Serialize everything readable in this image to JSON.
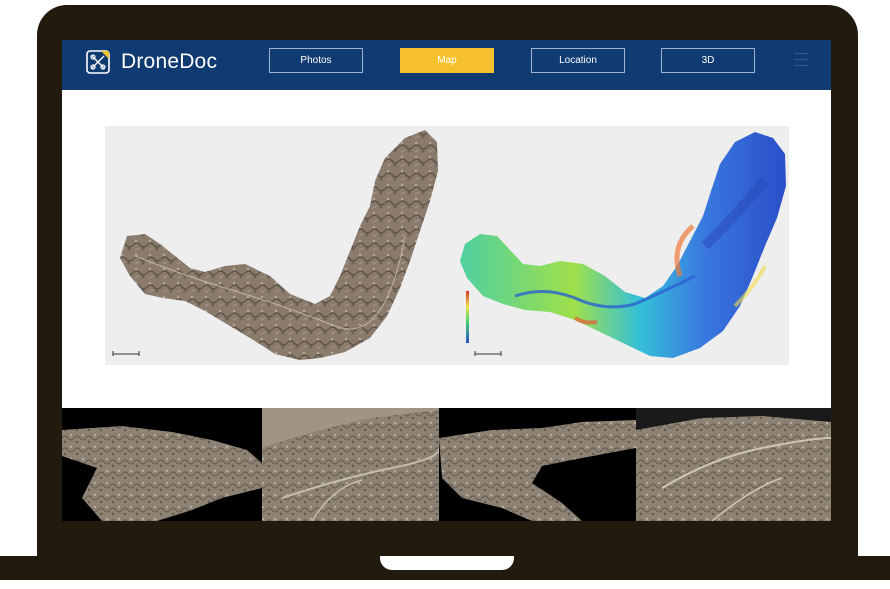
{
  "app": {
    "name": "DroneDoc"
  },
  "nav": [
    {
      "label": "Photos",
      "active": false
    },
    {
      "label": "Map",
      "active": true
    },
    {
      "label": "Location",
      "active": false
    },
    {
      "label": "3D",
      "active": false
    }
  ],
  "icons": {
    "logo": "drone-doc-logo-icon",
    "menu": "hamburger-menu-icon"
  },
  "colors": {
    "header": "#0f3a72",
    "active_tab": "#f6c12d",
    "device": "#231a0e"
  },
  "views": [
    {
      "name": "orthomosaic"
    },
    {
      "name": "elevation-model"
    }
  ],
  "thumbnails": 4
}
